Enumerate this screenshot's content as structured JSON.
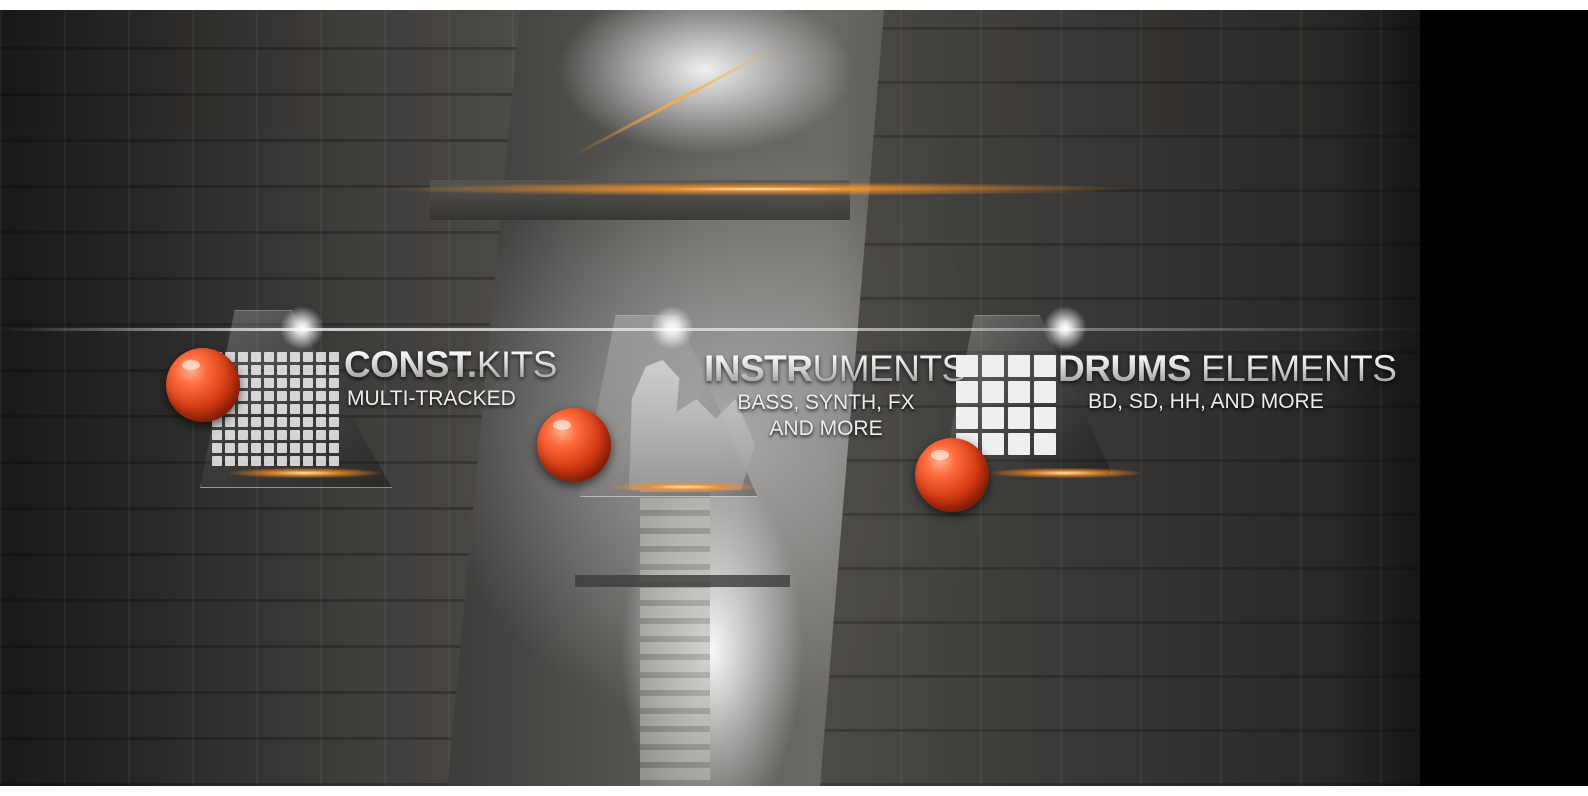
{
  "categories": [
    {
      "title_bold": "CONST.",
      "title_light": "KITS",
      "subtitle_lines": [
        "MULTI-TRACKED"
      ],
      "icon": "pad-grid-icon"
    },
    {
      "title_bold": "INSTR",
      "title_light": "UMENTS",
      "subtitle_lines": [
        "BASS, SYNTH, FX",
        "AND MORE"
      ],
      "icon": "instrument-silhouette-icon"
    },
    {
      "title_bold": "DRUMS",
      "title_light": " ELEMENTS",
      "subtitle_lines": [
        "BD, SD, HH, AND MORE"
      ],
      "icon": "drum-pads-icon"
    }
  ],
  "colors": {
    "bullet_orange": "#d13a12",
    "flare_orange": "#ff8c1a",
    "text_silver": "#cfcfcf"
  }
}
